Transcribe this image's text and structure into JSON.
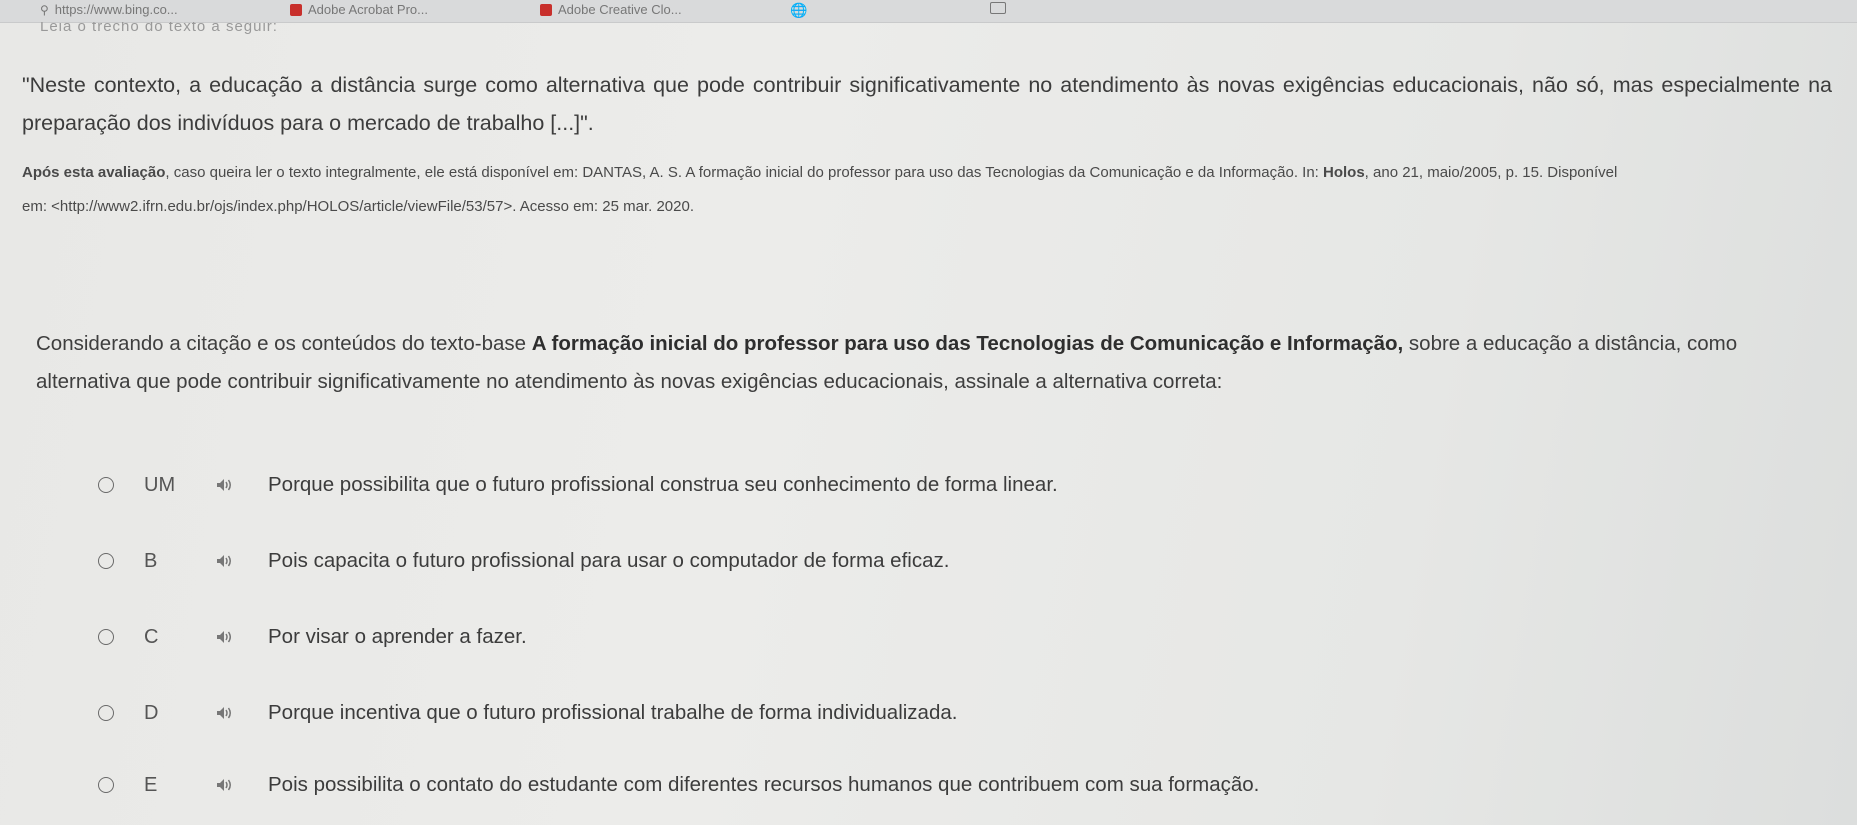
{
  "browser": {
    "bookmarks": [
      {
        "label": "https://www.bing.co...",
        "icon": "search-icon"
      },
      {
        "label": "Adobe Acrobat Pro...",
        "icon": "acrobat-icon"
      },
      {
        "label": "Adobe Creative Clo...",
        "icon": "creative-cloud-icon"
      }
    ]
  },
  "content": {
    "clipped_heading": "Leia o trecho do texto a seguir:",
    "quote": "\"Neste contexto, a educação a distância surge como alternativa que pode contribuir significativamente no atendimento às novas exigências educacionais, não só, mas especialmente na preparação dos indivíduos para o mercado de trabalho [...]\".",
    "reference_prefix": "Após esta avaliação",
    "reference_line1": ", caso queira ler o texto integralmente, ele está disponível em: DANTAS, A. S. A formação inicial do professor para uso das Tecnologias da Comunicação e da Informação. In: ",
    "reference_holos": "Holos",
    "reference_line1_end": ", ano 21, maio/2005, p. 15. Disponível",
    "reference_line2": "em: <http://www2.ifrn.edu.br/ojs/index.php/HOLOS/article/viewFile/53/57>. Acesso em: 25 mar. 2020.",
    "question_start": "Considerando a citação e os conteúdos do texto-base ",
    "question_bold": "A formação inicial do professor para uso das Tecnologias de Comunicação e Informação,",
    "question_end": " sobre a educação a distância, como alternativa que pode contribuir significativamente no atendimento às novas exigências educacionais, assinale a alternativa correta:"
  },
  "options": [
    {
      "letter": "UM",
      "text": "Porque possibilita que o futuro profissional construa seu conhecimento de forma linear."
    },
    {
      "letter": "B",
      "text": "Pois capacita o futuro profissional para usar o computador de forma eficaz."
    },
    {
      "letter": "C",
      "text": "Por visar o aprender a fazer."
    },
    {
      "letter": "D",
      "text": "Porque incentiva que o futuro profissional trabalhe de forma individualizada."
    },
    {
      "letter": "E",
      "text": "Pois possibilita o contato do estudante com diferentes recursos humanos que contribuem com sua formação."
    }
  ],
  "colors": {
    "acrobat": "#c8302c",
    "creative_cloud": "#c8302c"
  }
}
